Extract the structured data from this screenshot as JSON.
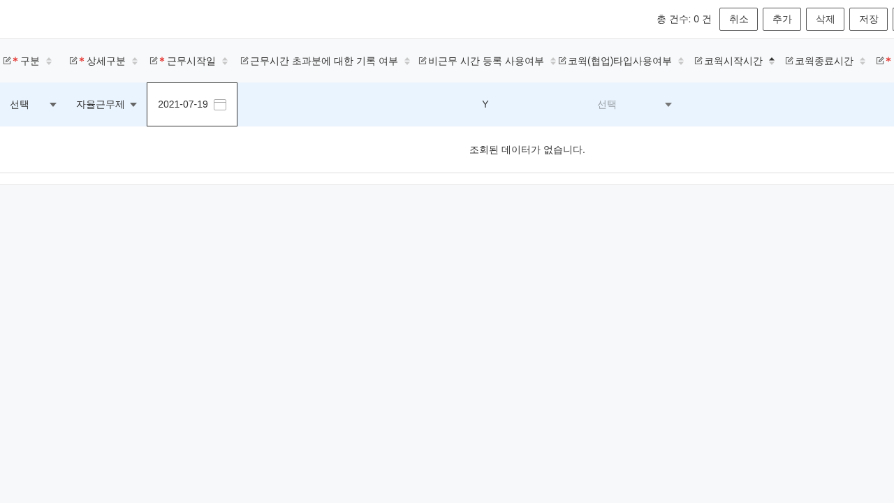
{
  "toolbar": {
    "total_count": "총 건수: 0 건",
    "buttons": [
      "취소",
      "추가",
      "삭제",
      "저장"
    ]
  },
  "table": {
    "columns": [
      {
        "label": "구분",
        "required": true,
        "editable": true,
        "sorted_ascending": false
      },
      {
        "label": "상세구분",
        "required": true,
        "editable": true,
        "sorted_ascending": false
      },
      {
        "label": "근무시작일",
        "required": true,
        "editable": true,
        "sorted_ascending": false
      },
      {
        "label": "근무시간 초과분에 대한 기록 여부",
        "required": false,
        "editable": true,
        "sorted_ascending": false
      },
      {
        "label": "비근무 시간 등록 사용여부",
        "required": false,
        "editable": true,
        "sorted_ascending": false
      },
      {
        "label": "코웍(협업)타입사용여부",
        "required": false,
        "editable": true,
        "sorted_ascending": false
      },
      {
        "label": "코웍시작시간",
        "required": false,
        "editable": true,
        "sorted_ascending": true
      },
      {
        "label": "코웍종료시간",
        "required": false,
        "editable": true,
        "sorted_ascending": false
      },
      {
        "required": true,
        "editable": true
      }
    ],
    "edit_row": [
      {
        "kind": "select",
        "value": "선택"
      },
      {
        "kind": "select",
        "value": "자율근무제"
      },
      {
        "kind": "date",
        "value": "2021-07-19"
      },
      {
        "kind": "empty"
      },
      {
        "kind": "text",
        "value": "Y"
      },
      {
        "kind": "select",
        "placeholder": "선택"
      },
      {
        "kind": "empty"
      },
      {
        "kind": "empty"
      },
      {
        "kind": "empty"
      }
    ],
    "empty_message": "조회된 데이터가 없습니다."
  }
}
